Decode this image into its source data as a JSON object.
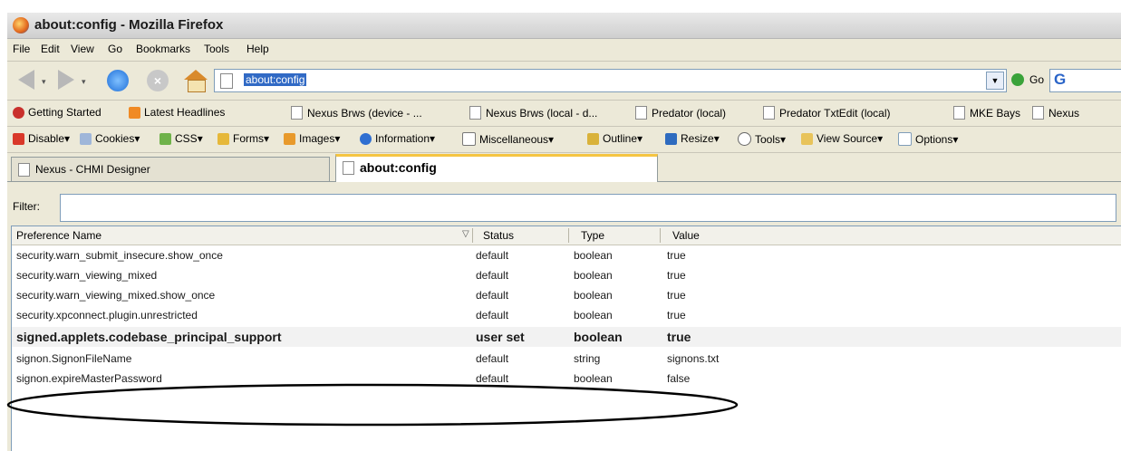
{
  "window": {
    "title": "about:config - Mozilla Firefox"
  },
  "menu": [
    "File",
    "Edit",
    "View",
    "Go",
    "Bookmarks",
    "Tools",
    "Help"
  ],
  "navigation": {
    "url": "about:config",
    "go_label": "Go",
    "search_logo": "G"
  },
  "bookmarks": [
    "Getting Started",
    "Latest Headlines",
    "Nexus Brws (device - ...",
    "Nexus Brws (local - d...",
    "Predator (local)",
    "Predator TxtEdit (local)",
    "MKE Bays",
    "Nexus"
  ],
  "devtools": [
    "Disable",
    "Cookies",
    "CSS",
    "Forms",
    "Images",
    "Information",
    "Miscellaneous",
    "Outline",
    "Resize",
    "Tools",
    "View Source",
    "Options"
  ],
  "tabs": [
    "Nexus - CHMI Designer",
    "about:config"
  ],
  "filter": {
    "label": "Filter:",
    "value": ""
  },
  "table": {
    "headers": [
      "Preference Name",
      "Status",
      "Type",
      "Value"
    ],
    "rows": [
      [
        "security.warn_submit_insecure.show_once",
        "default",
        "boolean",
        "true"
      ],
      [
        "security.warn_viewing_mixed",
        "default",
        "boolean",
        "true"
      ],
      [
        "security.warn_viewing_mixed.show_once",
        "default",
        "boolean",
        "true"
      ],
      [
        "security.xpconnect.plugin.unrestricted",
        "default",
        "boolean",
        "true"
      ],
      [
        "signed.applets.codebase_principal_support",
        "user set",
        "boolean",
        "true"
      ],
      [
        "signon.SignonFileName",
        "default",
        "string",
        "signons.txt"
      ],
      [
        "signon.expireMasterPassword",
        "default",
        "boolean",
        "false"
      ]
    ]
  },
  "annotation": {
    "shape": "ellipse",
    "color": "#000000",
    "highlighted_row": 4
  }
}
